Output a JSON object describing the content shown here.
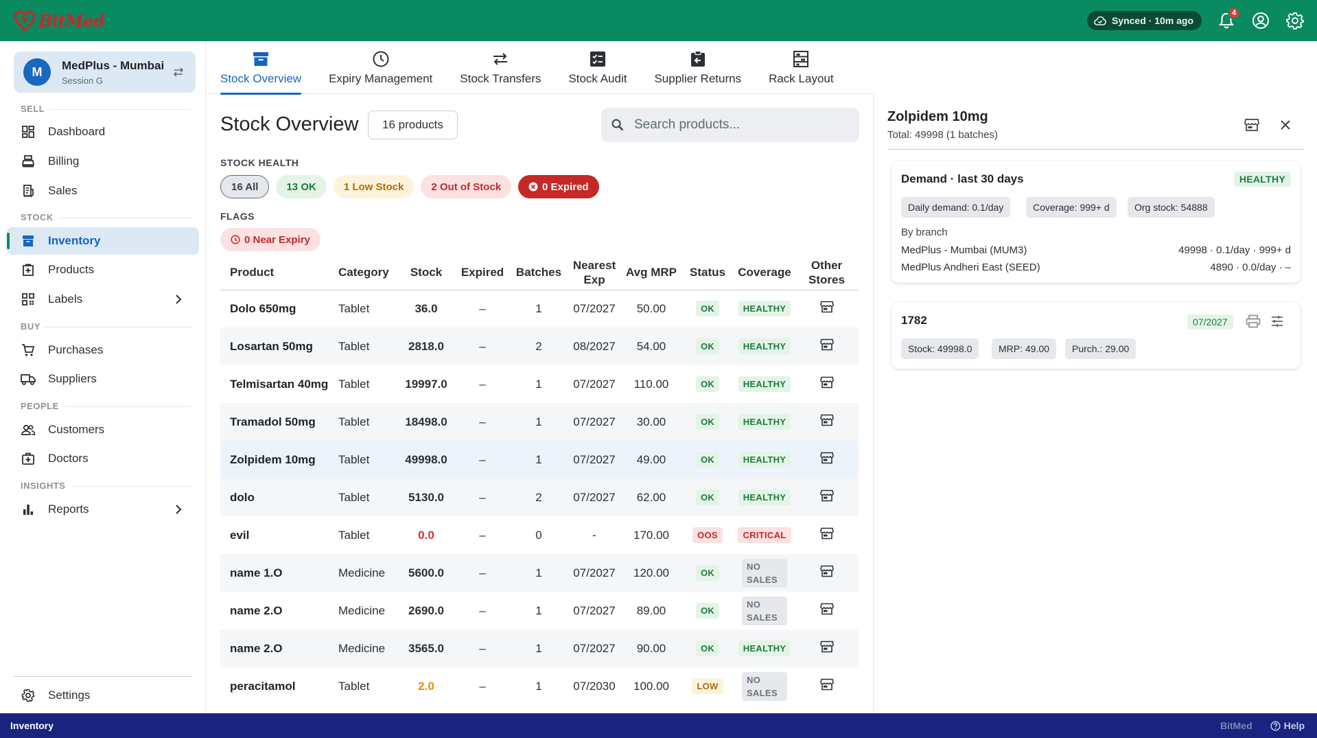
{
  "app": {
    "brand": "BitMed",
    "sync_status": "Synced · 10m ago",
    "notification_count": "4"
  },
  "sidebar": {
    "store_initial": "M",
    "store_name": "MedPlus - Mumbai",
    "session": "Session G",
    "sections": {
      "sell": "SELL",
      "stock": "STOCK",
      "buy": "BUY",
      "people": "PEOPLE",
      "insights": "INSIGHTS"
    },
    "items": {
      "dashboard": "Dashboard",
      "billing": "Billing",
      "sales": "Sales",
      "inventory": "Inventory",
      "products": "Products",
      "labels": "Labels",
      "purchases": "Purchases",
      "suppliers": "Suppliers",
      "customers": "Customers",
      "doctors": "Doctors",
      "reports": "Reports",
      "settings": "Settings"
    }
  },
  "tabs": [
    "Stock Overview",
    "Expiry Management",
    "Stock Transfers",
    "Stock Audit",
    "Supplier Returns",
    "Rack Layout"
  ],
  "main": {
    "title": "Stock Overview",
    "product_count": "16 products",
    "search_placeholder": "Search products...",
    "stock_health_label": "STOCK HEALTH",
    "flags_label": "FLAGS",
    "chips": {
      "all": "16 All",
      "ok": "13 OK",
      "low": "1 Low Stock",
      "out": "2 Out of Stock",
      "expired": "0 Expired"
    },
    "near_expiry": "0 Near Expiry"
  },
  "table": {
    "headers": {
      "product": "Product",
      "category": "Category",
      "stock": "Stock",
      "expired": "Expired",
      "batches": "Batches",
      "nearest_exp": "Nearest Exp",
      "avg_mrp": "Avg MRP",
      "status": "Status",
      "coverage": "Coverage",
      "other_stores": "Other Stores"
    },
    "rows": [
      {
        "product": "Dolo 650mg",
        "category": "Tablet",
        "stock": "36.0",
        "expired": "–",
        "batches": "1",
        "nearest_exp": "07/2027",
        "avg_mrp": "50.00",
        "status": "OK",
        "coverage": "HEALTHY"
      },
      {
        "product": "Losartan 50mg",
        "category": "Tablet",
        "stock": "2818.0",
        "expired": "–",
        "batches": "2",
        "nearest_exp": "08/2027",
        "avg_mrp": "54.00",
        "status": "OK",
        "coverage": "HEALTHY"
      },
      {
        "product": "Telmisartan 40mg",
        "category": "Tablet",
        "stock": "19997.0",
        "expired": "–",
        "batches": "1",
        "nearest_exp": "07/2027",
        "avg_mrp": "110.00",
        "status": "OK",
        "coverage": "HEALTHY"
      },
      {
        "product": "Tramadol 50mg",
        "category": "Tablet",
        "stock": "18498.0",
        "expired": "–",
        "batches": "1",
        "nearest_exp": "07/2027",
        "avg_mrp": "30.00",
        "status": "OK",
        "coverage": "HEALTHY"
      },
      {
        "product": "Zolpidem 10mg",
        "category": "Tablet",
        "stock": "49998.0",
        "expired": "–",
        "batches": "1",
        "nearest_exp": "07/2027",
        "avg_mrp": "49.00",
        "status": "OK",
        "coverage": "HEALTHY"
      },
      {
        "product": "dolo",
        "category": "Tablet",
        "stock": "5130.0",
        "expired": "–",
        "batches": "2",
        "nearest_exp": "07/2027",
        "avg_mrp": "62.00",
        "status": "OK",
        "coverage": "HEALTHY"
      },
      {
        "product": "evil",
        "category": "Tablet",
        "stock": "0.0",
        "expired": "–",
        "batches": "0",
        "nearest_exp": "-",
        "avg_mrp": "170.00",
        "status": "OOS",
        "coverage": "CRITICAL"
      },
      {
        "product": "name 1.O",
        "category": "Medicine",
        "stock": "5600.0",
        "expired": "–",
        "batches": "1",
        "nearest_exp": "07/2027",
        "avg_mrp": "120.00",
        "status": "OK",
        "coverage": "NO SALES"
      },
      {
        "product": "name 2.O",
        "category": "Medicine",
        "stock": "2690.0",
        "expired": "–",
        "batches": "1",
        "nearest_exp": "07/2027",
        "avg_mrp": "89.00",
        "status": "OK",
        "coverage": "NO SALES"
      },
      {
        "product": "name 2.O",
        "category": "Medicine",
        "stock": "3565.0",
        "expired": "–",
        "batches": "1",
        "nearest_exp": "07/2027",
        "avg_mrp": "90.00",
        "status": "OK",
        "coverage": "HEALTHY"
      },
      {
        "product": "peracitamol",
        "category": "Tablet",
        "stock": "2.0",
        "expired": "–",
        "batches": "1",
        "nearest_exp": "07/2030",
        "avg_mrp": "100.00",
        "status": "LOW",
        "coverage": "NO SALES"
      }
    ]
  },
  "panel": {
    "title": "Zolpidem 10mg",
    "subtitle": "Total: 49998 (1 batches)",
    "demand": {
      "title": "Demand · last 30 days",
      "badge": "HEALTHY",
      "daily_demand": "Daily demand: 0.1/day",
      "coverage": "Coverage: 999+ d",
      "org_stock": "Org stock: 54888",
      "by_branch": "By branch",
      "branches": [
        {
          "name": "MedPlus - Mumbai (MUM3)",
          "value": "49998 · 0.1/day · 999+ d"
        },
        {
          "name": "MedPlus Andheri East (SEED)",
          "value": "4890 · 0.0/day · –"
        }
      ]
    },
    "batch": {
      "id": "1782",
      "expiry": "07/2027",
      "stock": "Stock: 49998.0",
      "mrp": "MRP: 49.00",
      "purchase": "Purch.: 29.00"
    }
  },
  "statusbar": {
    "page": "Inventory",
    "brand": "BitMed",
    "help": "Help"
  }
}
